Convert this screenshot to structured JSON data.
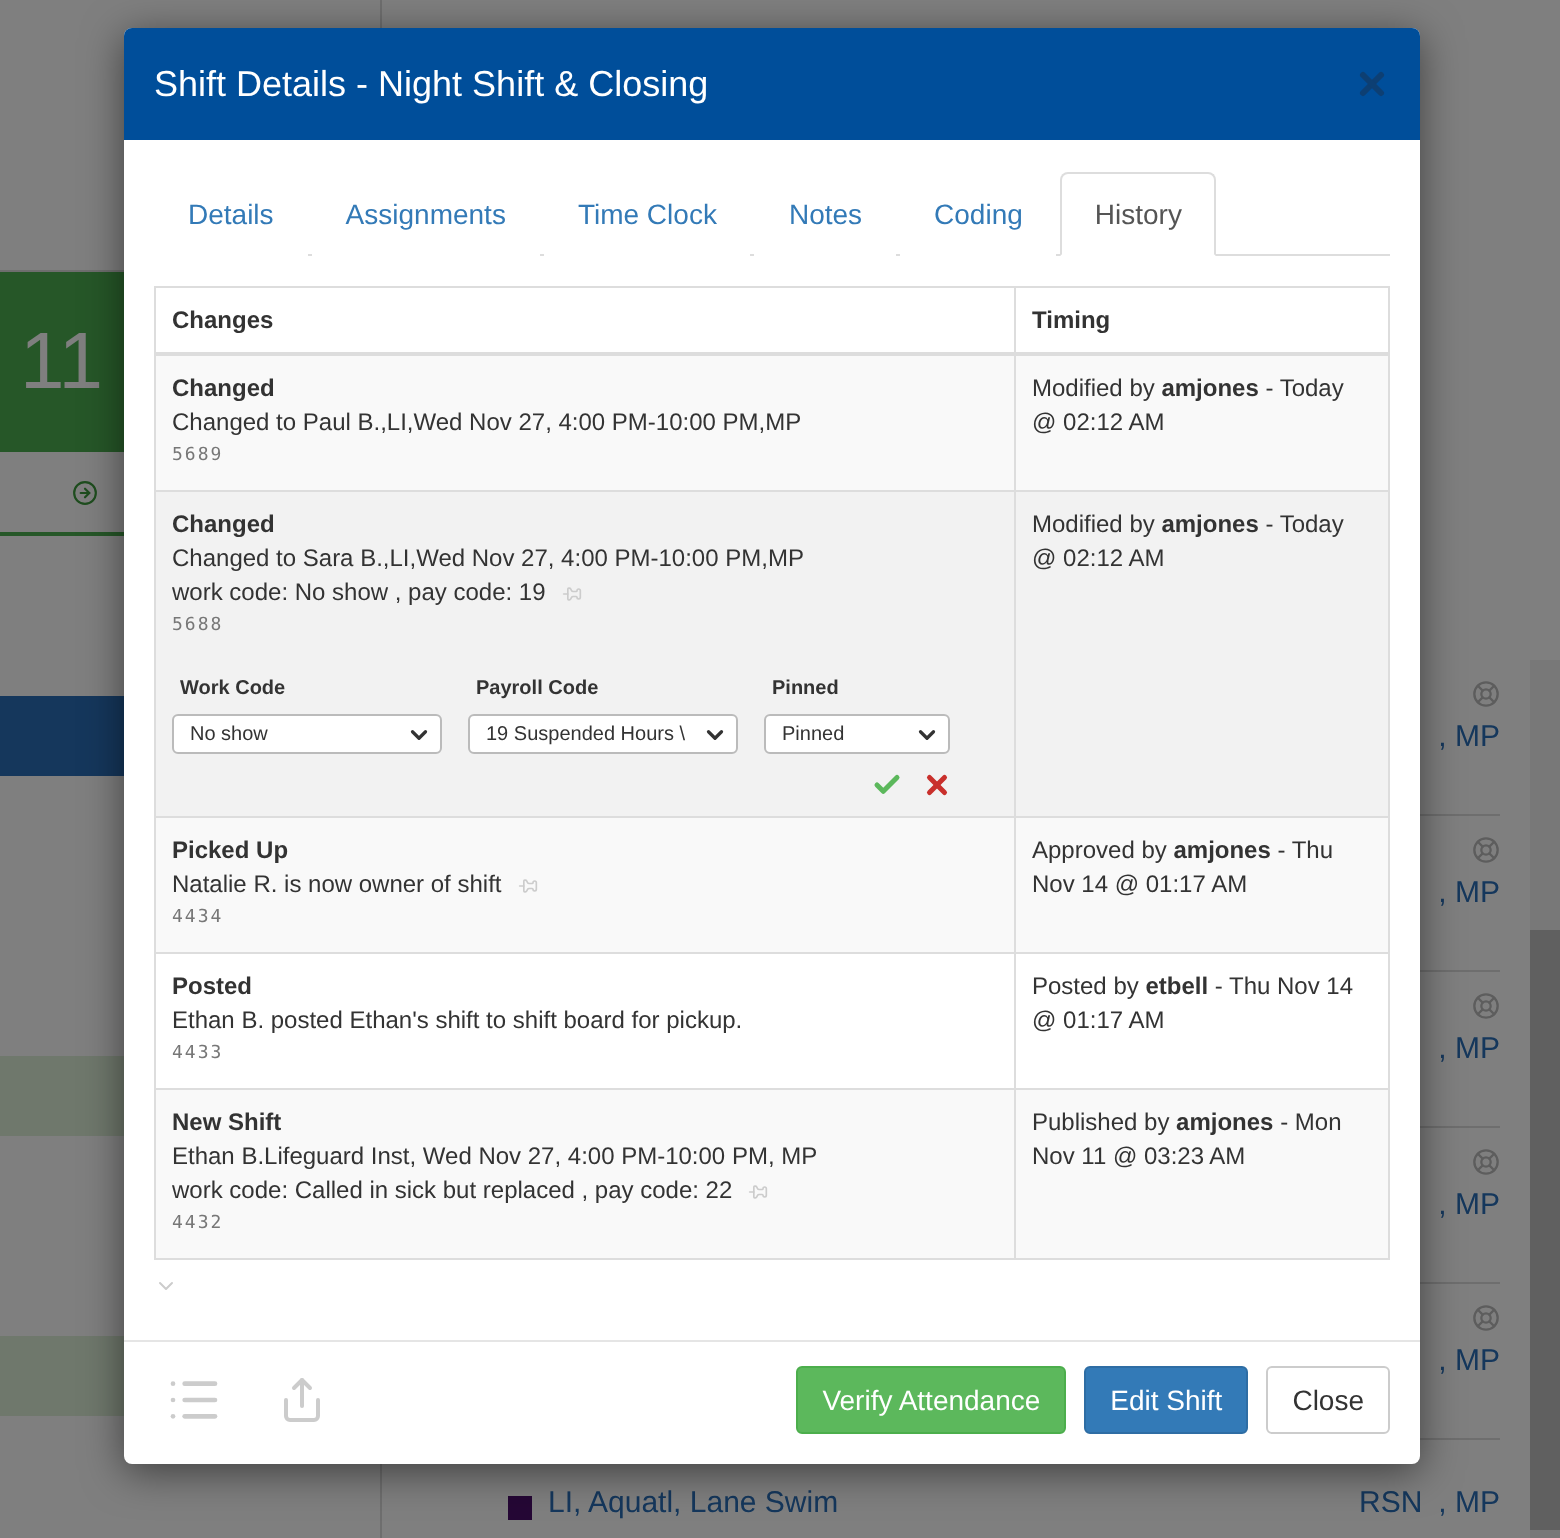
{
  "background": {
    "tile_count": "11",
    "rows": [
      {
        "text": ", MP"
      },
      {
        "text": ", MP"
      },
      {
        "text": ", MP"
      },
      {
        "text": ", MP"
      },
      {
        "text": ", MP"
      }
    ],
    "last_row": {
      "name": "LI, Aquatl, Lane Swim",
      "code": "RSN",
      "suffix": ", MP"
    }
  },
  "dialog": {
    "title": "Shift Details - Night Shift & Closing",
    "tabs": [
      {
        "label": "Details",
        "selected": false
      },
      {
        "label": "Assignments",
        "selected": false
      },
      {
        "label": "Time Clock",
        "selected": false
      },
      {
        "label": "Notes",
        "selected": false
      },
      {
        "label": "Coding",
        "selected": false
      },
      {
        "label": "History",
        "selected": true
      }
    ],
    "table": {
      "columns": [
        "Changes",
        "Timing"
      ],
      "rows": [
        {
          "title": "Changed",
          "lines": [
            "Changed to Paul B.,LI,Wed Nov 27, 4:00 PM-10:00 PM,MP"
          ],
          "pinned": false,
          "id": "5689",
          "timing": "Modified by **amjones** - Today @ 02:12 AM"
        },
        {
          "title": "Changed",
          "lines": [
            "Changed to Sara B.,LI,Wed Nov 27, 4:00 PM-10:00 PM,MP",
            "work code: No show , pay code: 19"
          ],
          "pinned": true,
          "id": "5688",
          "timing": "Modified by **amjones** - Today @ 02:12 AM",
          "editor": {
            "fields": [
              {
                "label": "Work Code",
                "value": "No show"
              },
              {
                "label": "Payroll Code",
                "value": "19 Suspended Hours \\"
              },
              {
                "label": "Pinned",
                "value": "Pinned"
              }
            ]
          }
        },
        {
          "title": "Picked Up",
          "lines": [
            "Natalie R. is now owner of shift"
          ],
          "pinned": true,
          "id": "4434",
          "timing": "Approved by **amjones** - Thu Nov 14 @ 01:17 AM"
        },
        {
          "title": "Posted",
          "lines": [
            "Ethan B. posted Ethan's shift to shift board for pickup."
          ],
          "pinned": false,
          "id": "4433",
          "timing": "Posted by **etbell** - Thu Nov 14 @ 01:17 AM"
        },
        {
          "title": "New Shift",
          "lines": [
            "Ethan B.Lifeguard Inst, Wed Nov 27, 4:00 PM-10:00 PM, MP",
            "work code: Called in sick but replaced , pay code: 22"
          ],
          "pinned": true,
          "id": "4432",
          "timing": "Published by **amjones** - Mon Nov 11 @ 03:23 AM"
        }
      ]
    },
    "buttons": [
      {
        "label": "Verify Attendance",
        "kind": "success"
      },
      {
        "label": "Edit Shift",
        "kind": "primary"
      },
      {
        "label": "Close",
        "kind": "default"
      }
    ]
  }
}
